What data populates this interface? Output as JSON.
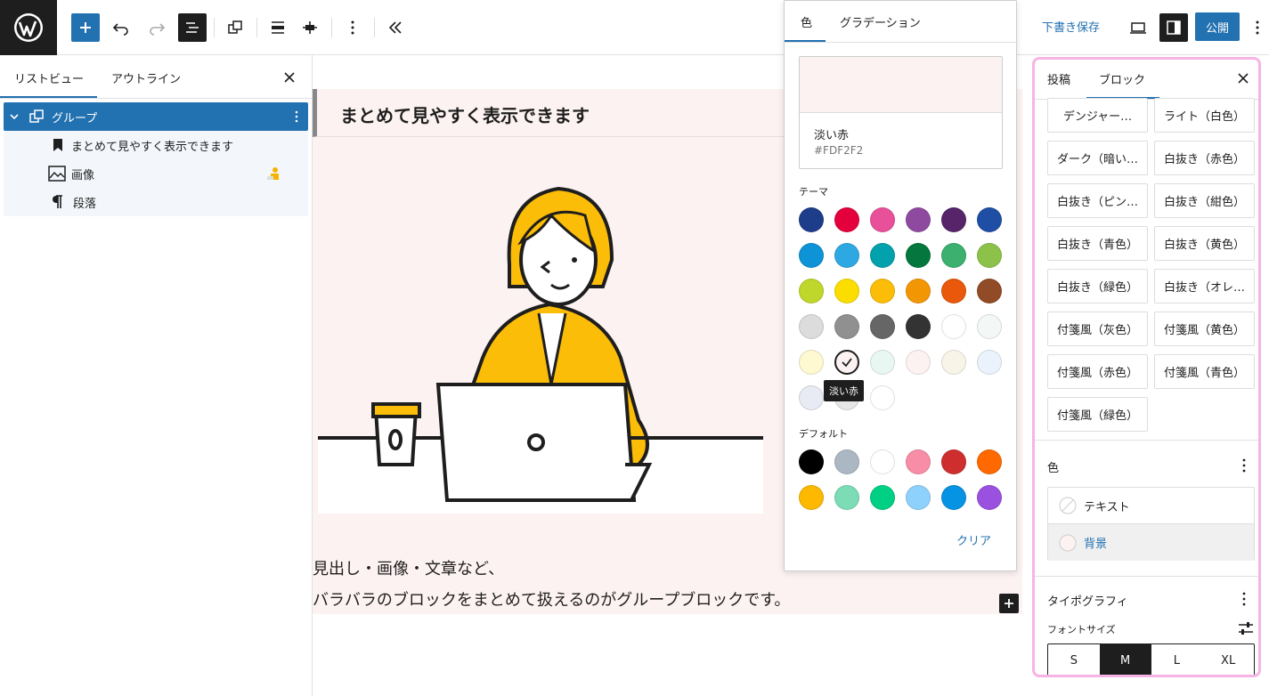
{
  "toolbar": {
    "save_draft": "下書き保存",
    "publish": "公開"
  },
  "left_panel": {
    "tabs": [
      "リストビュー",
      "アウトライン"
    ],
    "tree": [
      {
        "label": "グループ"
      },
      {
        "label": "まとめて見やすく表示できます"
      },
      {
        "label": "画像"
      },
      {
        "label": "段落"
      }
    ]
  },
  "canvas": {
    "heading": "まとめて見やすく表示できます",
    "paragraph_line1": "見出し・画像・文章など、",
    "paragraph_line2": "バラバラのブロックをまとめて扱えるのがグループブロックです。"
  },
  "color_popover": {
    "tabs": [
      "色",
      "グラデーション"
    ],
    "selected_name": "淡い赤",
    "selected_hex": "#FDF2F2",
    "theme_label": "テーマ",
    "default_label": "デフォルト",
    "tooltip": "淡い赤",
    "clear": "クリア",
    "theme_colors": [
      "#1d3d8b",
      "#e4003c",
      "#e8509a",
      "#8e4a9f",
      "#57246a",
      "#1f4ea5",
      "#0e93d6",
      "#2ea8e3",
      "#03a1ae",
      "#03773d",
      "#3bb06f",
      "#8cc24a",
      "#bfd62b",
      "#fcdd00",
      "#fbbd08",
      "#f39604",
      "#e9580b",
      "#924b27",
      "#dcdcdc",
      "#909090",
      "#666666",
      "#333333",
      "#ffffff",
      "#f3f8f7",
      "#fef9d1",
      "#fdf2f2",
      "#e9f7f2",
      "#fdf2f2",
      "#f9f4e8",
      "#eaf3fb",
      "#e8ebf3",
      "#e6e6e6",
      "#ffffff"
    ],
    "default_colors": [
      "#000000",
      "#abb8c3",
      "#ffffff",
      "#f78da7",
      "#cf2e2e",
      "#ff6900",
      "#fcb900",
      "#7bdcb5",
      "#00d084",
      "#8ed1fc",
      "#0693e3",
      "#9b51e0"
    ]
  },
  "right_sidebar": {
    "tabs": [
      "投稿",
      "ブロック"
    ],
    "styles": [
      "デンジャー…",
      "ライト（白色）",
      "ダーク（暗い…",
      "白抜き（赤色）",
      "白抜き（ピン…",
      "白抜き（紺色）",
      "白抜き（青色）",
      "白抜き（黄色）",
      "白抜き（緑色）",
      "白抜き（オレ…",
      "付箋風（灰色）",
      "付箋風（黄色）",
      "付箋風（赤色）",
      "付箋風（青色）",
      "付箋風（緑色）"
    ],
    "color_section": "色",
    "color_text": "テキスト",
    "color_background": "背景",
    "typography": "タイポグラフィ",
    "font_size_label": "フォントサイズ",
    "sizes": [
      "S",
      "M",
      "L",
      "XL"
    ],
    "selected_size": "M",
    "highlight_color": "#f5b4e5"
  }
}
